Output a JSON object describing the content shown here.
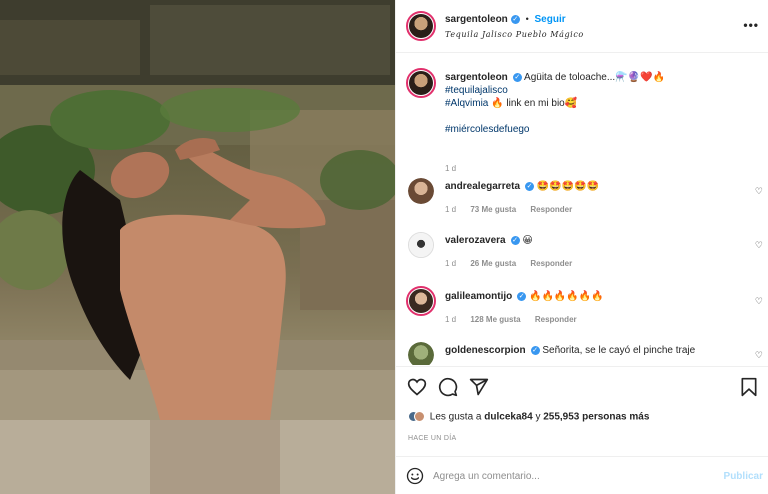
{
  "post": {
    "username": "sargentoleon",
    "follow_label": "Seguir",
    "separator": "•",
    "location": "Tequila Jalisco Pueblo Mágico"
  },
  "caption": {
    "username": "sargentoleon",
    "line1": "Agüita de toloache...⚗️🔮❤️🔥",
    "hashtag1": "#tequilajalisco",
    "hashtag2": "#Alqvimia",
    "line3_rest": "🔥 link en mi bio🥰",
    "hashtag3": "#miércolesdefuego",
    "age": "1 d"
  },
  "comments": [
    {
      "username": "andrealegarreta",
      "text": "🤩🤩🤩🤩🤩",
      "age": "1 d",
      "likes": "73 Me gusta",
      "reply": "Responder",
      "verified": true
    },
    {
      "username": "valerozavera",
      "text": "😀",
      "age": "1 d",
      "likes": "26 Me gusta",
      "reply": "Responder",
      "verified": true
    },
    {
      "username": "galileamontijo",
      "text": "🔥🔥🔥🔥🔥🔥",
      "age": "1 d",
      "likes": "128 Me gusta",
      "reply": "Responder",
      "verified": true
    },
    {
      "username": "goldenescorpion",
      "text": "Señorita, se le cayó el pinche traje",
      "verified": true
    }
  ],
  "likes": {
    "prefix": "Les gusta a",
    "user": "dulceka84",
    "middle": "y",
    "count": "255,953 personas más"
  },
  "time_ago": "HACE UN DÍA",
  "add_comment": {
    "placeholder": "Agrega un comentario...",
    "publish_label": "Publicar"
  },
  "icons": {
    "more": "more-options-icon",
    "heart": "heart-icon",
    "comment": "comment-icon",
    "share": "share-icon",
    "save": "bookmark-icon",
    "emoji": "emoji-icon"
  },
  "colors": {
    "accent": "#0095f6",
    "link": "#00376b",
    "verified": "#3897f0",
    "muted": "#8e8e8e"
  }
}
